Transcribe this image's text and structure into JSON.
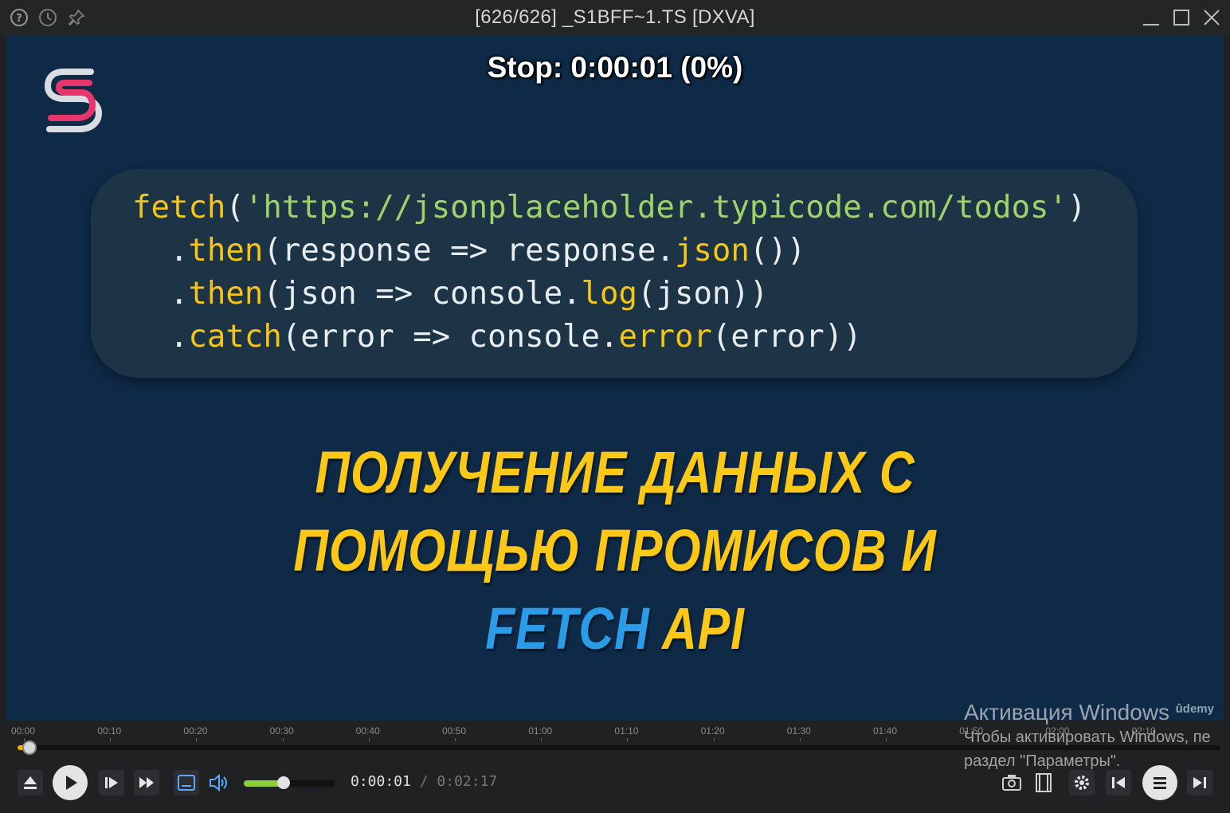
{
  "window": {
    "title": "[626/626] _S1BFF~1.TS [DXVA]",
    "left_icons": [
      "help-icon",
      "clock-icon",
      "pin-icon"
    ],
    "right_controls": [
      "minimize-icon",
      "maximize-icon",
      "close-icon"
    ]
  },
  "video": {
    "osd": "Stop: 0:00:01 (0%)",
    "logo": "S",
    "code": {
      "line1": {
        "fn": "fetch",
        "open": "(",
        "url": "'https://jsonplaceholder.typicode.com/todos'",
        "close": ")"
      },
      "line2": {
        "dot": ".",
        "method": "then",
        "body": "(response => response.",
        "call": "json",
        "end": "())"
      },
      "line3": {
        "dot": ".",
        "method": "then",
        "body": "(json => console.",
        "call": "log",
        "end": "(json))"
      },
      "line4": {
        "dot": ".",
        "method": "catch",
        "body": "(error => console.",
        "call": "error",
        "end": "(error))"
      }
    },
    "headline": {
      "line1": "ПОЛУЧЕНИЕ ДАННЫХ С",
      "line2": "ПОМОЩЬЮ ПРОМИСОВ И",
      "line3_blue": "FETCH",
      "line3_yellow": "API"
    },
    "udemy": "ûdemy"
  },
  "timeline": {
    "ticks": [
      "00:00",
      "00:10",
      "00:20",
      "00:30",
      "00:40",
      "00:50",
      "01:00",
      "01:10",
      "01:20",
      "01:30",
      "01:40",
      "01:50",
      "02:00",
      "02:10"
    ],
    "progress_percent": 0
  },
  "controls": {
    "buttons_left": [
      "eject-icon",
      "play-icon",
      "step-forward-icon",
      "fast-forward-icon",
      "subtitles-icon",
      "volume-icon"
    ],
    "volume_percent": 40,
    "current_time": "0:00:01",
    "separator": "/",
    "duration": "0:02:17",
    "buttons_right": [
      "screenshot-icon",
      "film-icon",
      "settings-icon",
      "previous-icon",
      "playlist-icon",
      "next-icon"
    ]
  },
  "watermark": {
    "title": "Активация Windows",
    "line1": "Чтобы активировать Windows, пе",
    "line2": "раздел \"Параметры\"."
  }
}
